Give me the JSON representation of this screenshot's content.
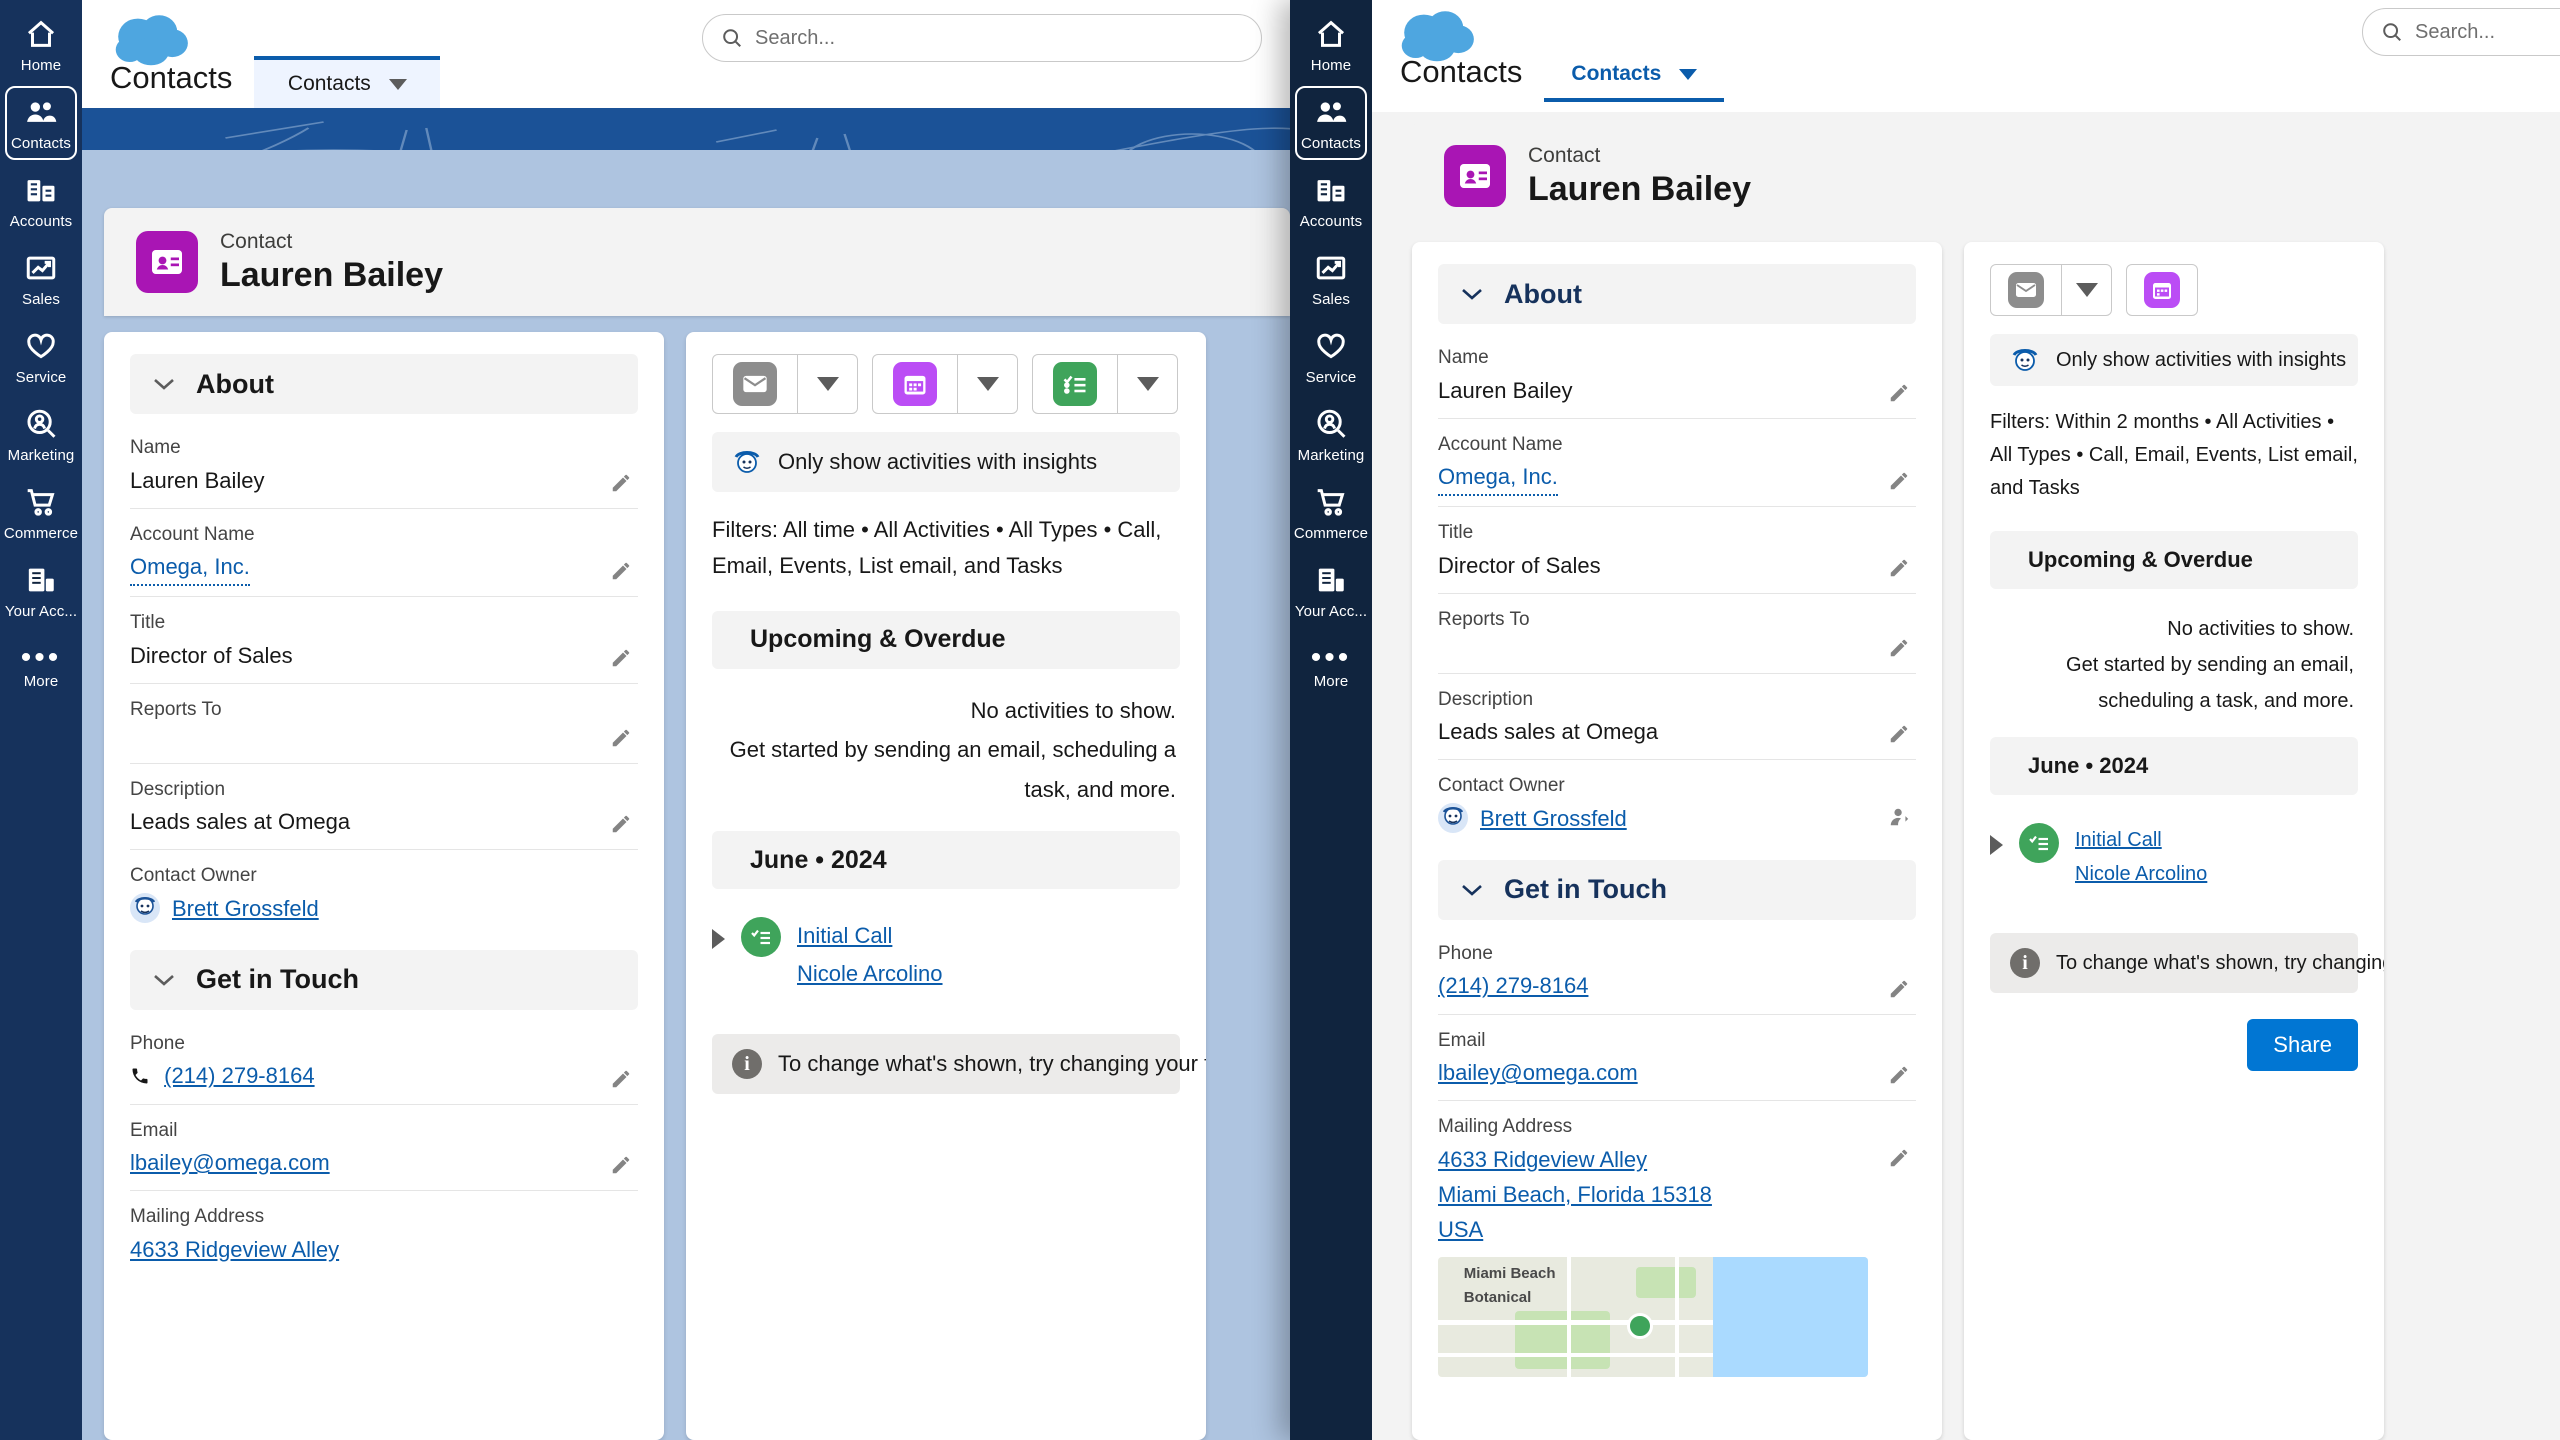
{
  "app": {
    "logo": "salesforce-cloud-logo",
    "search_placeholder": "Search..."
  },
  "nav": {
    "items": [
      {
        "label": "Home",
        "icon": "home-icon",
        "active": false
      },
      {
        "label": "Contacts",
        "icon": "contacts-icon",
        "active": true
      },
      {
        "label": "Accounts",
        "icon": "accounts-icon",
        "active": false
      },
      {
        "label": "Sales",
        "icon": "sales-chart-icon",
        "active": false
      },
      {
        "label": "Service",
        "icon": "service-heart-icon",
        "active": false
      },
      {
        "label": "Marketing",
        "icon": "marketing-person-icon",
        "active": false
      },
      {
        "label": "Commerce",
        "icon": "commerce-cart-icon",
        "active": false
      },
      {
        "label": "Your Acc...",
        "icon": "your-account-icon",
        "active": false
      },
      {
        "label": "More",
        "icon": "more-dots-icon",
        "active": false
      }
    ]
  },
  "object_tabs": {
    "page_title": "Contacts",
    "tab_label": "Contacts"
  },
  "record": {
    "type_label": "Contact",
    "name": "Lauren Bailey",
    "avatar_icon": "contact-card-icon"
  },
  "about": {
    "section_title": "About",
    "fields": [
      {
        "label": "Name",
        "value": "Lauren Bailey",
        "link": false
      },
      {
        "label": "Account Name",
        "value": "Omega, Inc.",
        "link": true
      },
      {
        "label": "Title",
        "value": "Director of Sales",
        "link": false
      },
      {
        "label": "Reports To",
        "value": "",
        "link": false
      },
      {
        "label": "Description",
        "value": "Leads sales at Omega",
        "link": false
      },
      {
        "label": "Contact Owner",
        "value": "Brett Grossfeld",
        "link": true
      }
    ]
  },
  "get_in_touch": {
    "section_title": "Get in Touch",
    "fields": [
      {
        "label": "Phone",
        "value": "(214) 279-8164",
        "link": true
      },
      {
        "label": "Email",
        "value": "lbailey@omega.com",
        "link": true
      },
      {
        "label": "Mailing Address",
        "value": "4633 Ridgeview Alley",
        "line2": "Miami Beach, Florida 15318",
        "line3": "USA",
        "link": true
      }
    ]
  },
  "activity": {
    "buttons": [
      {
        "name": "email-action",
        "icon": "email-icon",
        "color": "gray"
      },
      {
        "name": "event-action",
        "icon": "calendar-icon",
        "color": "purple"
      },
      {
        "name": "task-action",
        "icon": "task-list-icon",
        "color": "green"
      }
    ],
    "only_show_label": "Only show activities with insights",
    "filters_left": "Filters: All time  •  All Activities  •  All Types  • Call, Email, Events, List email, and Tasks",
    "filters_right": "Filters: Within 2 months  •  All Activities  •  All Types  • Call, Email, Events, List email, and Tasks",
    "upcoming_title": "Upcoming & Overdue",
    "empty_primary": "No activities to show.",
    "empty_secondary": "Get started by sending an email, scheduling a task, and more.",
    "month_group": "June • 2024",
    "timeline_item": {
      "title": "Initial Call",
      "person": "Nicole Arcolino"
    },
    "info_text": "To change what's shown, try changing your filters.",
    "share_label": "Share"
  },
  "map": {
    "label_city": "Miami Beach",
    "label_park": "Botanical",
    "pin": "location-pin-icon"
  }
}
